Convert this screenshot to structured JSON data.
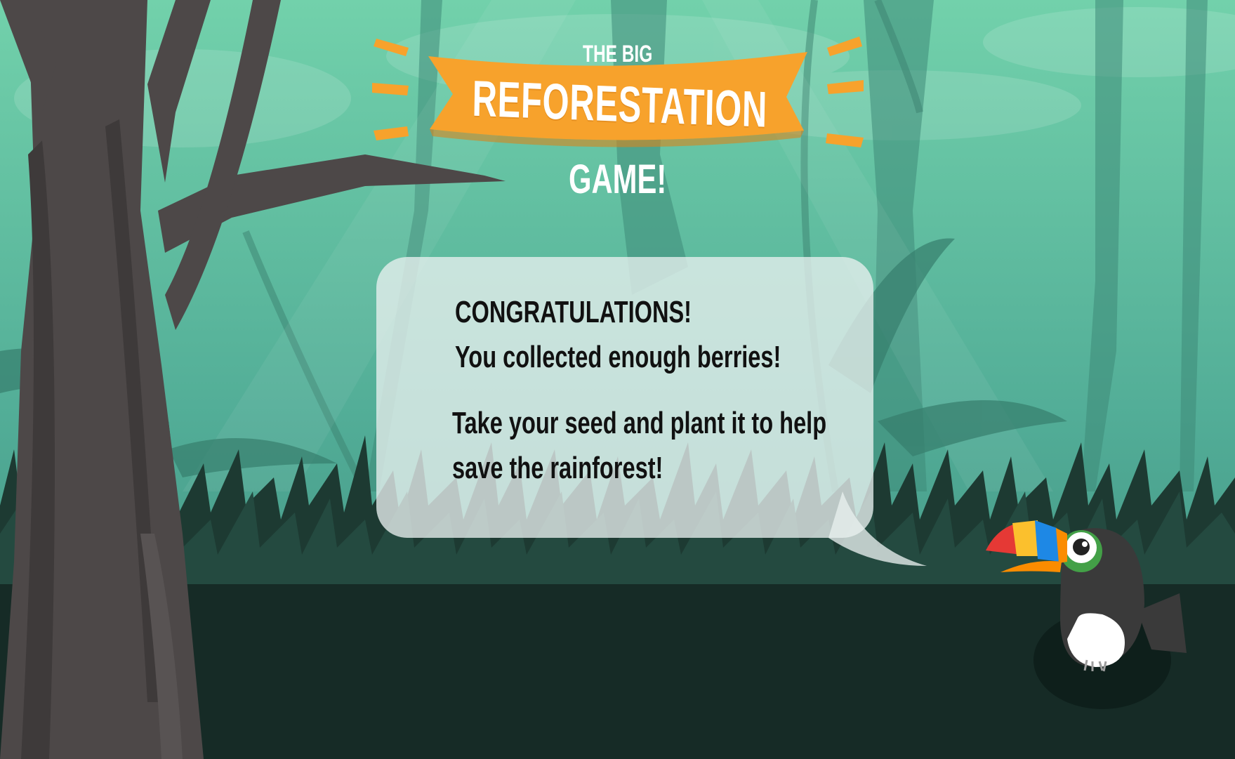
{
  "game": {
    "title_top": "THE BIG",
    "title_banner": "REFORESTATION",
    "title_bottom": "GAME!"
  },
  "dialog": {
    "heading": "CONGRATULATIONS!",
    "line1": "You collected enough berries!",
    "line2": "Take your seed and plant it to help",
    "line3": "save the rainforest!"
  },
  "character": {
    "name": "toucan-icon",
    "beak_colors": [
      "#e53935",
      "#fbc02d",
      "#1e88e5",
      "#fb8c00"
    ],
    "eye_ring_color": "#43a047"
  },
  "colors": {
    "sky_top": "#6fcfa8",
    "sky_bottom": "#3f8f80",
    "ground": "#162b26",
    "banner": "#f7a22c",
    "tree": "#4a4646"
  }
}
